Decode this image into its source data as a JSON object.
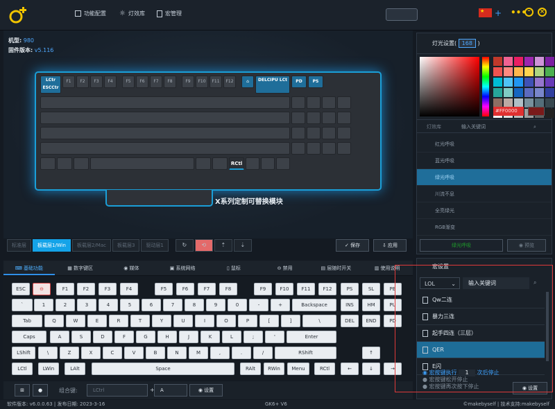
{
  "nav": {
    "items": [
      {
        "label": "功能配置"
      },
      {
        "label": "灯效库"
      },
      {
        "label": "宏管理"
      }
    ]
  },
  "header": {
    "plus": "+"
  },
  "device": {
    "model_label": "机型:",
    "model": "980",
    "fw_label": "固件版本:",
    "fw": "v5.116"
  },
  "keyboard_image": {
    "row1": [
      "LCtr ESCCtr",
      "F1",
      "F2",
      "F3",
      "F4",
      "F5",
      "F6",
      "F7",
      "F8",
      "F9",
      "F10",
      "F11",
      "F12",
      "",
      "DELCIPU LCt",
      "PD",
      "PS"
    ],
    "row5_right": "RCtl",
    "module_label": "X系列定制可替换模块"
  },
  "layers": {
    "items": [
      {
        "label": "标准层"
      },
      {
        "label": "板载层1/Win"
      },
      {
        "label": "板载层2/Mac"
      },
      {
        "label": "板载层3"
      },
      {
        "label": "驱动层1"
      }
    ],
    "save": "保存",
    "apply": "应用"
  },
  "tabs": [
    {
      "label": "基础功能"
    },
    {
      "label": "数字键区"
    },
    {
      "label": "媒体"
    },
    {
      "label": "系统网络"
    },
    {
      "label": "鼠标"
    },
    {
      "label": "禁用"
    },
    {
      "label": "层随时开关"
    },
    {
      "label": "使用说明"
    }
  ],
  "vkeys": {
    "r0": [
      "ESC",
      "",
      "F1",
      "F2",
      "F3",
      "F4",
      "F5",
      "F6",
      "F7",
      "F8",
      "F9",
      "F10",
      "F11",
      "F12",
      "PS",
      "SL",
      "PB"
    ],
    "r1": [
      "`",
      "1",
      "2",
      "3",
      "4",
      "5",
      "6",
      "7",
      "8",
      "9",
      "0",
      "-",
      "+",
      "Backspace",
      "INS",
      "HM",
      "PU"
    ],
    "r2": [
      "Tab",
      "Q",
      "W",
      "E",
      "R",
      "T",
      "Y",
      "U",
      "I",
      "O",
      "P",
      "[",
      "]",
      "\\",
      "DEL",
      "END",
      "PD"
    ],
    "r3": [
      "Caps",
      "A",
      "S",
      "D",
      "F",
      "G",
      "H",
      "J",
      "K",
      "L",
      ";",
      "'",
      "Enter"
    ],
    "r4": [
      "LShift",
      "\\",
      "Z",
      "X",
      "C",
      "V",
      "B",
      "N",
      "M",
      ",",
      ".",
      "/",
      "RShift",
      "↑"
    ],
    "r5": [
      "LCtl",
      "LWin",
      "LAlt",
      "Space",
      "RAlt",
      "RWin",
      "Menu",
      "RCtl",
      "←",
      "↓",
      "→"
    ]
  },
  "combo": {
    "label": "组合键:",
    "select": "LCtrl",
    "plus": "+",
    "key": "A",
    "button": "设置"
  },
  "status": {
    "left": "软件版本: v6.0.0.63 | 发布日期: 2023-3-16",
    "center": "GK6+ V6",
    "right": "©makebyself | 技术支持:makebyself"
  },
  "lighting": {
    "title": "灯光设置",
    "count": "168",
    "hex": "#FF0000",
    "tab_label": "灯效库",
    "search_placeholder": "输入关键词",
    "effects": [
      {
        "label": "红光呼吸"
      },
      {
        "label": "蓝光呼吸"
      },
      {
        "label": "绿光呼吸"
      },
      {
        "label": "川流不息"
      },
      {
        "label": "全亮绿光"
      },
      {
        "label": "RGB渐变"
      }
    ],
    "selected_effect": "绿光呼吸",
    "preview": "预览",
    "colors": [
      "#c0392b",
      "#f06292",
      "#e91e63",
      "#9c27b0",
      "#ce93d8",
      "#7b1fa2",
      "#ef5350",
      "#ff8a80",
      "#ffb74d",
      "#ffd54f",
      "#aed581",
      "#4caf50",
      "#00bcd4",
      "#4fc3f7",
      "#2196f3",
      "#3f51b5",
      "#9575cd",
      "#673ab7",
      "#26a69a",
      "#80cbc4",
      "#1565c0",
      "#5c6bc0",
      "#7986cb",
      "#303f9f",
      "#8d6e63",
      "#bcaaa4",
      "#b0bec5",
      "#78909c",
      "#546e7a",
      "#37474f",
      "#f5f5f5",
      "#e0e0e0",
      "#bdbdbd",
      "#9e9e9e",
      "#616161",
      "#212121"
    ]
  },
  "macro": {
    "title": "宏设置",
    "filter": "LOL",
    "search_placeholder": "输入关键词",
    "items": [
      {
        "label": "Qw二连"
      },
      {
        "label": "暴力三连"
      },
      {
        "label": "起手四连（三层）"
      },
      {
        "label": "QER"
      },
      {
        "label": "E闪"
      }
    ],
    "opt1_a": "宏按键执行",
    "opt1_count": "1",
    "opt1_b": "次后停止",
    "opt2": "宏按键松开停止",
    "opt3": "宏按键再次按下停止",
    "settings": "设置"
  }
}
